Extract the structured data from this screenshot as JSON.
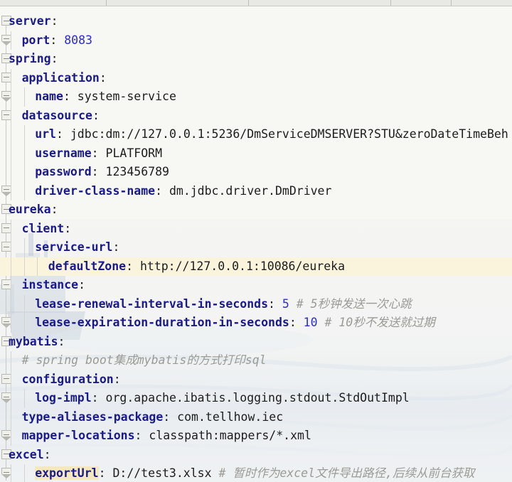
{
  "window": {
    "type": "ide-code-editor",
    "file_language": "YAML",
    "background_color": "#f7f7f3",
    "key_color": "#1a1a8c",
    "number_color": "#2b2bdd",
    "comment_color": "#9a9a96",
    "highlight_line_color": "#faf4dd",
    "search_match_color": "#f4e9be"
  },
  "toolbar": {
    "segments": [
      "",
      "",
      "",
      "",
      ""
    ]
  },
  "code": {
    "lines": [
      {
        "indent": 0,
        "key": "server",
        "colon": ":",
        "value": "",
        "value_type": "none",
        "comment": "",
        "fold": "start",
        "line_highlight": false,
        "key_highlight": false
      },
      {
        "indent": 1,
        "key": "port",
        "colon": ":",
        "value": "8083",
        "value_type": "number",
        "comment": "",
        "fold": "end",
        "line_highlight": false,
        "key_highlight": false
      },
      {
        "indent": 0,
        "key": "spring",
        "colon": ":",
        "value": "",
        "value_type": "none",
        "comment": "",
        "fold": "start",
        "line_highlight": false,
        "key_highlight": false
      },
      {
        "indent": 1,
        "key": "application",
        "colon": ":",
        "value": "",
        "value_type": "none",
        "comment": "",
        "fold": "start",
        "line_highlight": false,
        "key_highlight": false
      },
      {
        "indent": 2,
        "key": "name",
        "colon": ":",
        "value": "system-service",
        "value_type": "string",
        "comment": "",
        "fold": "end",
        "line_highlight": false,
        "key_highlight": false
      },
      {
        "indent": 1,
        "key": "datasource",
        "colon": ":",
        "value": "",
        "value_type": "none",
        "comment": "",
        "fold": "start",
        "line_highlight": false,
        "key_highlight": false
      },
      {
        "indent": 2,
        "key": "url",
        "colon": ":",
        "value": "jdbc:dm://127.0.0.1:5236/DmServiceDMSERVER?STU&zeroDateTimeBeh",
        "value_type": "string",
        "comment": "",
        "fold": "none",
        "line_highlight": false,
        "key_highlight": false
      },
      {
        "indent": 2,
        "key": "username",
        "colon": ":",
        "value": "PLATFORM",
        "value_type": "string",
        "comment": "",
        "fold": "none",
        "line_highlight": false,
        "key_highlight": false
      },
      {
        "indent": 2,
        "key": "password",
        "colon": ":",
        "value": "123456789",
        "value_type": "string",
        "comment": "",
        "fold": "none",
        "line_highlight": false,
        "key_highlight": false
      },
      {
        "indent": 2,
        "key": "driver-class-name",
        "colon": ":",
        "value": "dm.jdbc.driver.DmDriver",
        "value_type": "string",
        "comment": "",
        "fold": "end",
        "line_highlight": false,
        "key_highlight": false
      },
      {
        "indent": 0,
        "key": "eureka",
        "colon": ":",
        "value": "",
        "value_type": "none",
        "comment": "",
        "fold": "start",
        "line_highlight": false,
        "key_highlight": false
      },
      {
        "indent": 1,
        "key": "client",
        "colon": ":",
        "value": "",
        "value_type": "none",
        "comment": "",
        "fold": "start",
        "line_highlight": false,
        "key_highlight": false
      },
      {
        "indent": 2,
        "key": "service-url",
        "colon": ":",
        "value": "",
        "value_type": "none",
        "comment": "",
        "fold": "start",
        "line_highlight": false,
        "key_highlight": false
      },
      {
        "indent": 3,
        "key": "defaultZone",
        "colon": ":",
        "value": "http://127.0.0.1:10086/eureka",
        "value_type": "string",
        "comment": "",
        "fold": "end",
        "line_highlight": true,
        "key_highlight": false
      },
      {
        "indent": 1,
        "key": "instance",
        "colon": ":",
        "value": "",
        "value_type": "none",
        "comment": "",
        "fold": "start",
        "line_highlight": false,
        "key_highlight": false
      },
      {
        "indent": 2,
        "key": "lease-renewal-interval-in-seconds",
        "colon": ":",
        "value": "5",
        "value_type": "number",
        "comment": "# 5秒钟发送一次心跳",
        "fold": "none",
        "line_highlight": false,
        "key_highlight": false
      },
      {
        "indent": 2,
        "key": "lease-expiration-duration-in-seconds",
        "colon": ":",
        "value": "10",
        "value_type": "number",
        "comment": "# 10秒不发送就过期",
        "fold": "end",
        "line_highlight": false,
        "key_highlight": false
      },
      {
        "indent": 0,
        "key": "mybatis",
        "colon": ":",
        "value": "",
        "value_type": "none",
        "comment": "",
        "fold": "start",
        "line_highlight": false,
        "key_highlight": false
      },
      {
        "indent": 1,
        "key": "",
        "colon": "",
        "value": "",
        "value_type": "none",
        "comment": "# spring boot集成mybatis的方式打印sql",
        "fold": "none",
        "line_highlight": false,
        "key_highlight": false
      },
      {
        "indent": 1,
        "key": "configuration",
        "colon": ":",
        "value": "",
        "value_type": "none",
        "comment": "",
        "fold": "start",
        "line_highlight": false,
        "key_highlight": false
      },
      {
        "indent": 2,
        "key": "log-impl",
        "colon": ":",
        "value": "org.apache.ibatis.logging.stdout.StdOutImpl",
        "value_type": "string",
        "comment": "",
        "fold": "end",
        "line_highlight": false,
        "key_highlight": false
      },
      {
        "indent": 1,
        "key": "type-aliases-package",
        "colon": ":",
        "value": "com.tellhow.iec",
        "value_type": "string",
        "comment": "",
        "fold": "none",
        "line_highlight": false,
        "key_highlight": false
      },
      {
        "indent": 1,
        "key": "mapper-locations",
        "colon": ":",
        "value": "classpath:mappers/*.xml",
        "value_type": "string",
        "comment": "",
        "fold": "end",
        "line_highlight": false,
        "key_highlight": false
      },
      {
        "indent": 0,
        "key": "excel",
        "colon": ":",
        "value": "",
        "value_type": "none",
        "comment": "",
        "fold": "start",
        "line_highlight": false,
        "key_highlight": false
      },
      {
        "indent": 2,
        "key": "exportUrl",
        "colon": ":",
        "value": "D://test3.xlsx",
        "value_type": "string",
        "comment": "# 暂时作为excel文件导出路径,后续从前台获取",
        "fold": "end",
        "line_highlight": false,
        "key_highlight": true
      }
    ]
  }
}
